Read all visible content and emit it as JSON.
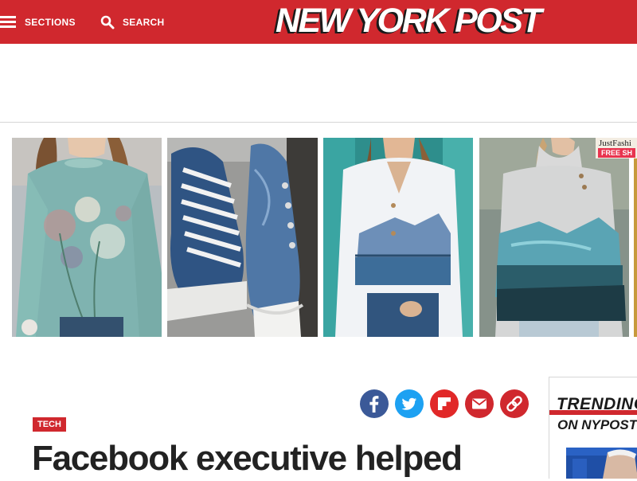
{
  "header": {
    "sections_label": "SECTIONS",
    "search_label": "SEARCH",
    "logo_text": "NEW YORK POST",
    "brand_color": "#d0282e",
    "icons": [
      "hamburger-icon",
      "search-icon"
    ]
  },
  "ad": {
    "store_name": "JustFashi",
    "shipping_badge": "FREE SH"
  },
  "carousel": {
    "products": [
      {
        "name": "floral-sweatshirt"
      },
      {
        "name": "denim-sneakers"
      },
      {
        "name": "landscape-print-cardigan"
      },
      {
        "name": "landscape-print-cowl-neck-top"
      }
    ]
  },
  "share": {
    "icons": [
      "facebook-icon",
      "twitter-icon",
      "flipboard-icon",
      "email-icon",
      "link-icon"
    ],
    "colors": {
      "facebook": "#3b5998",
      "twitter": "#1da1f2",
      "flipboard": "#e12828",
      "email": "#d0282e",
      "link": "#d0282e"
    }
  },
  "article": {
    "category": "TECH",
    "headline": "Facebook executive helped"
  },
  "trending": {
    "title": "TRENDING",
    "subtitle": "ON NYPOST"
  }
}
